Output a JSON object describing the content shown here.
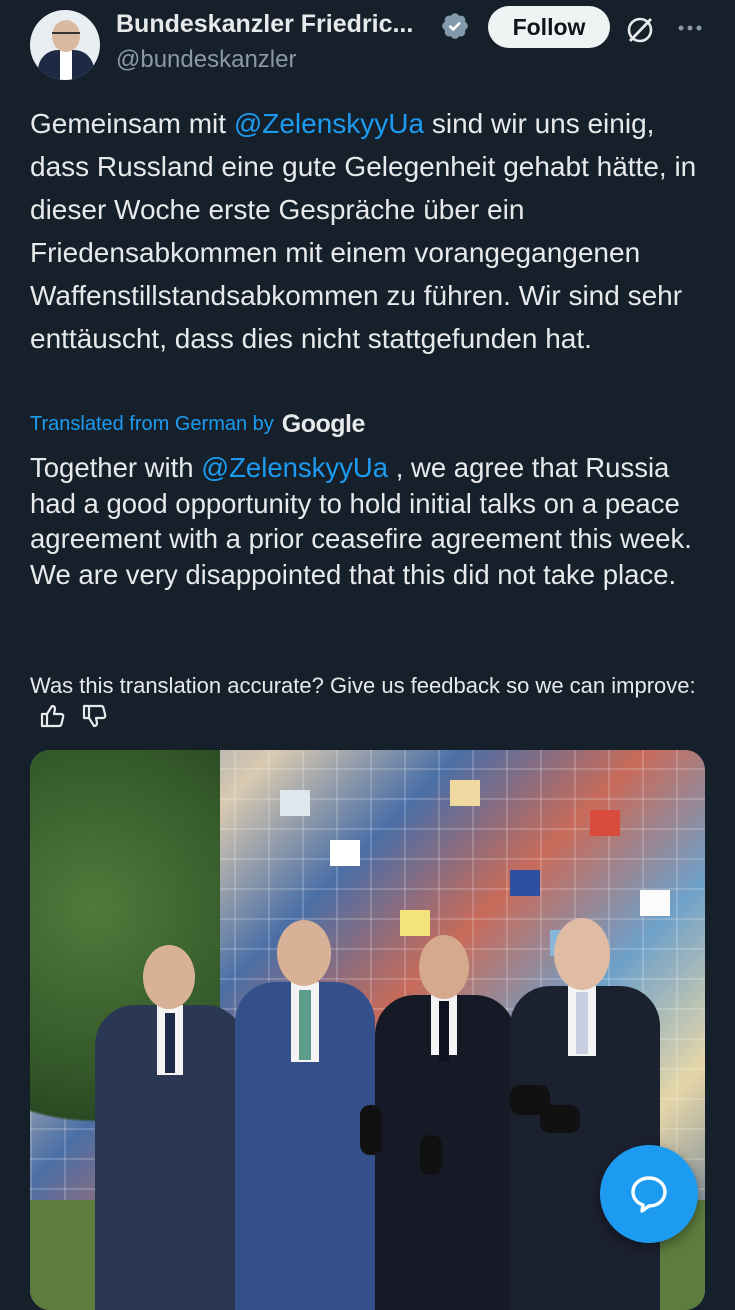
{
  "author": {
    "name": "Bundeskanzler Friedric...",
    "handle": "@bundeskanzler"
  },
  "actions": {
    "follow_label": "Follow"
  },
  "post": {
    "part1": "Gemeinsam mit ",
    "mention": "@ZelenskyyUa",
    "part2": " sind wir uns einig, dass Russland eine gute Gelegenheit gehabt hätte, in dieser Woche erste Gespräche über ein Friedensabkommen mit einem vorangegangenen Waffenstillstandsabkommen zu führen. Wir sind sehr enttäuscht, dass dies nicht stattgefunden hat."
  },
  "translation": {
    "label": "Translated from German by",
    "provider": "Google",
    "part1": "Together with ",
    "mention": "@ZelenskyyUa",
    "part2": " , we agree that Russia had a good opportunity to hold initial talks on a peace agreement with a prior ceasefire agreement this week. We are very disappointed that this did not take place."
  },
  "feedback": {
    "text": "Was this translation accurate? Give us feedback so we can improve:"
  },
  "colors": {
    "background": "#15202b",
    "accent": "#1d9bf0",
    "text": "#e7e9ea",
    "muted": "#8b98a5"
  },
  "icons": [
    "verified-badge-icon",
    "grok-icon",
    "more-options-icon",
    "thumbs-up-icon",
    "thumbs-down-icon",
    "reply-chat-icon"
  ]
}
